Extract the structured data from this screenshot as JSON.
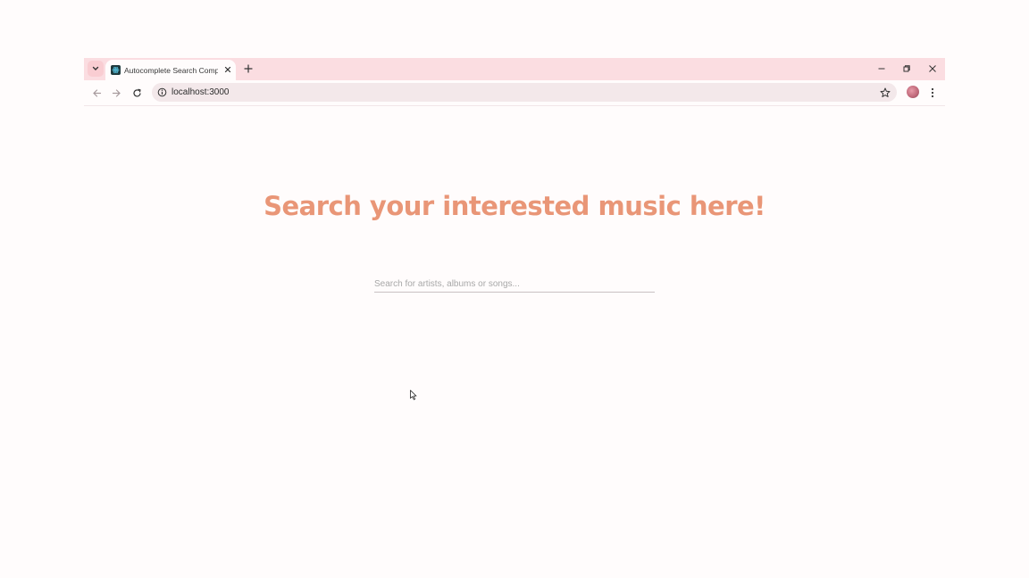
{
  "browser": {
    "tab": {
      "title": "Autocomplete Search Compo",
      "favicon": "react-logo-icon"
    },
    "new_tab_icon": "plus-icon",
    "window_controls": [
      "minimize-icon",
      "restore-icon",
      "close-icon"
    ],
    "nav": [
      "back-icon",
      "forward-icon",
      "reload-icon"
    ],
    "url": "localhost:3000",
    "accent": "#fbdde1"
  },
  "page": {
    "heading": "Search your interested music here!",
    "heading_color": "#e99677",
    "search": {
      "placeholder": "Search for artists, albums or songs...",
      "value": ""
    }
  }
}
